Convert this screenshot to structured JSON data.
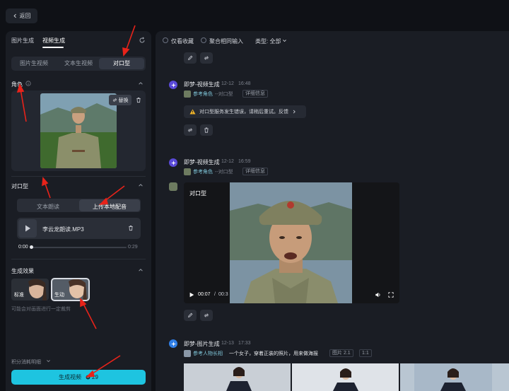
{
  "topbar": {
    "back_label": "返回"
  },
  "left": {
    "tabs": [
      "图片生成",
      "视频生成"
    ],
    "modes": [
      "图片生视频",
      "文本生视频",
      "对口型"
    ],
    "role": {
      "title": "角色",
      "replace_label": "替换"
    },
    "lip": {
      "title": "对口型",
      "options": [
        "文本朗读",
        "上传本地配音"
      ],
      "file_name": "李云龙朗读.MP3",
      "current_time": "0:00",
      "duration": "0:29",
      "progress": 0
    },
    "effect": {
      "title": "生成效果",
      "options": [
        "标准",
        "生动"
      ],
      "selected": "生动",
      "hint": "可能会对画面进行一定裁剪"
    },
    "points_label": "积分消耗明细",
    "generate": {
      "label": "生成视频",
      "cost": "29"
    }
  },
  "right": {
    "filters": {
      "favorites": "仅看收藏",
      "aggregate": "聚合相同输入",
      "type": "类型: 全部"
    },
    "messages": [
      {
        "name": "即梦-视频生成",
        "date": "12-12",
        "time": "16:48",
        "ref": "参考角色",
        "mode": "--对口型",
        "detail": "详细信息",
        "error": "对口型服务发生错误，请稍后重试。反馈"
      },
      {
        "name": "即梦-视频生成",
        "date": "12-12",
        "time": "16:59",
        "ref": "参考角色",
        "mode": "--对口型",
        "detail": "详细信息",
        "video_label": "对口型",
        "video_time": "00:07",
        "video_total": "00:3"
      },
      {
        "name": "即梦-图片生成",
        "date": "12-13",
        "time": "17:33",
        "ref": "参考人物长相",
        "prompt": "一个女子，穿着正装的照片，用来做海报",
        "model": "图片 2.1",
        "ratio": "1:1"
      }
    ]
  },
  "colors": {
    "accent": "#1ec4e0",
    "bg": "#0f1116",
    "panel": "#1a1d24",
    "arrow": "#e8231a"
  }
}
